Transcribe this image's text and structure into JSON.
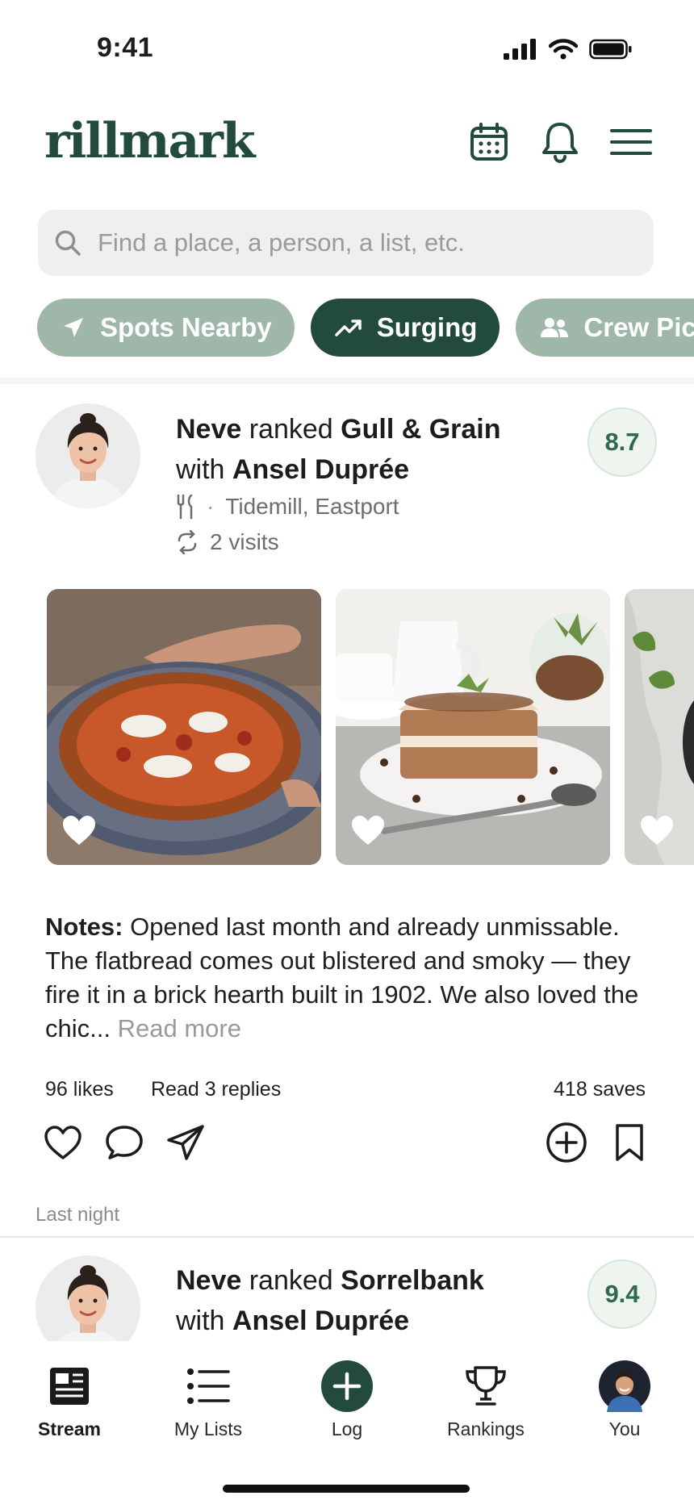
{
  "status_bar": {
    "time": "9:41"
  },
  "header": {
    "logo": "rillmark"
  },
  "search": {
    "placeholder": "Find a place, a person, a list, etc."
  },
  "chips": [
    {
      "label": "Spots Nearby",
      "icon": "location-arrow-icon",
      "active": false
    },
    {
      "label": "Surging",
      "icon": "trending-up-icon",
      "active": true
    },
    {
      "label": "Crew Picks",
      "icon": "people-icon",
      "active": false
    }
  ],
  "post": {
    "user": "Neve",
    "verb": "ranked",
    "place": "Gull & Grain",
    "with_word": "with",
    "companion": "Ansel Duprée",
    "score": "8.7",
    "location": "Tidemill, Eastport",
    "visits": "2 visits",
    "notes_label": "Notes:",
    "notes_text": "Opened last month and already unmissable. The flatbread comes out blistered and smoky — they fire it in a brick hearth built in 1902. We also loved the chic...",
    "read_more": "Read more",
    "likes": "96 likes",
    "replies": "Read 3 replies",
    "saves": "418 saves",
    "timestamp": "Last night"
  },
  "post2": {
    "user": "Neve",
    "verb": "ranked",
    "place": "Sorrelbank",
    "with_word": "with",
    "companion": "Ansel Duprée",
    "score": "9.4"
  },
  "tabs": [
    {
      "label": "Stream",
      "icon": "newspaper-icon",
      "active": true
    },
    {
      "label": "My Lists",
      "icon": "list-icon",
      "active": false
    },
    {
      "label": "Log",
      "icon": "plus-circle-icon",
      "active": false
    },
    {
      "label": "Rankings",
      "icon": "trophy-icon",
      "active": false
    },
    {
      "label": "You",
      "icon": "profile-avatar",
      "active": false
    }
  ],
  "colors": {
    "brand": "#234a3e",
    "chip_light": "#9fb7a8",
    "score_text": "#2f6a4f"
  }
}
